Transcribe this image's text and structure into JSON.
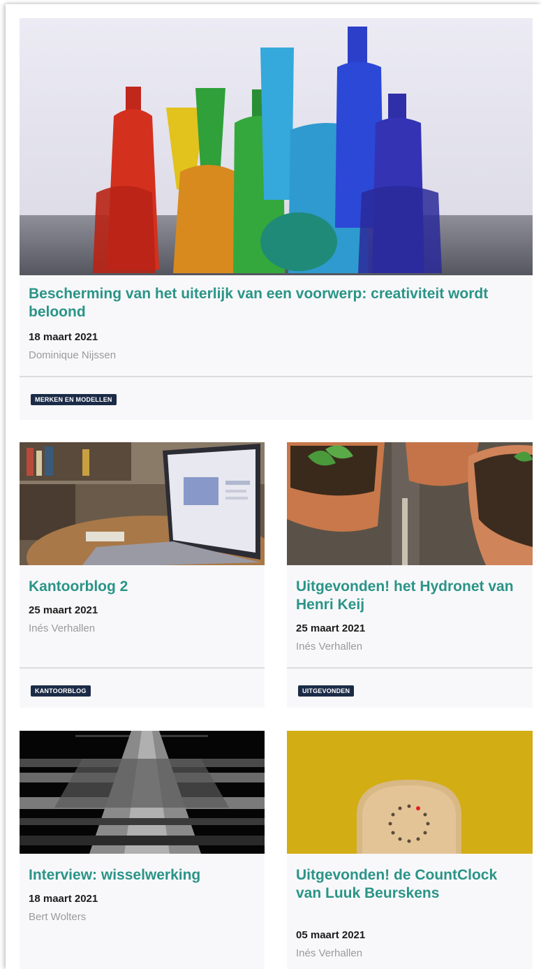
{
  "articles": [
    {
      "title": "Bescherming van het uiterlijk van een voorwerp: creativiteit wordt beloond",
      "date": "18 maart 2021",
      "author": "Dominique Nijssen",
      "tag": "MERKEN EN MODELLEN",
      "image": "colored-glass-bottles-photo"
    },
    {
      "title": "Kantoorblog 2",
      "date": "25 maart 2021",
      "author": "Inés Verhallen",
      "tag": "KANTOORBLOG",
      "image": "laptop-on-desk-photo"
    },
    {
      "title": "Uitgevonden! het Hydronet van Henri Keij",
      "date": "25 maart 2021",
      "author": "Inés Verhallen",
      "tag": "UITGEVONDEN",
      "image": "plant-pots-photo"
    },
    {
      "title": "Interview: wisselwerking",
      "date": "18 maart 2021",
      "author": "Bert Wolters",
      "tag": "",
      "image": "railway-switch-render"
    },
    {
      "title": "Uitgevonden! de CountClock van Luuk Beurskens",
      "date": "05 maart 2021",
      "author": "Inés Verhallen",
      "tag": "",
      "image": "wooden-countclock-photo"
    }
  ],
  "colors": {
    "title": "#2a9487",
    "tag_bg": "#1b2b47",
    "card_bg": "#f8f8fa"
  }
}
